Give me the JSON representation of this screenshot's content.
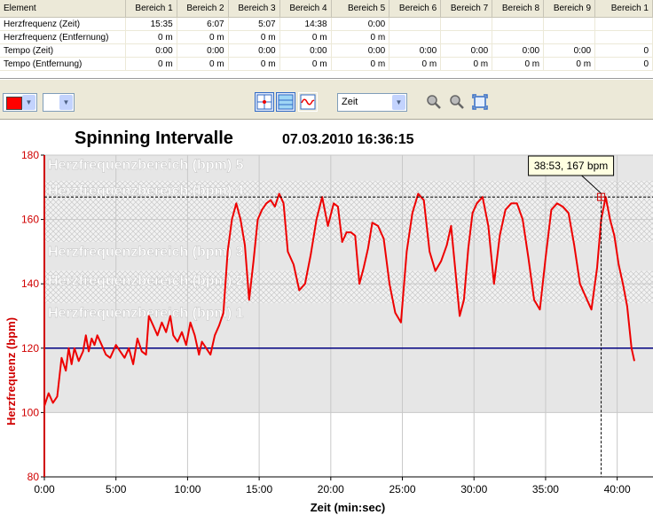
{
  "table": {
    "headers": [
      "Element",
      "Bereich 1",
      "Bereich 2",
      "Bereich 3",
      "Bereich 4",
      "Bereich 5",
      "Bereich 6",
      "Bereich 7",
      "Bereich 8",
      "Bereich 9",
      "Bereich 1"
    ],
    "rows": [
      {
        "label": "Herzfrequenz (Zeit)",
        "values": [
          "15:35",
          "6:07",
          "5:07",
          "14:38",
          "0:00",
          "",
          "",
          "",
          "",
          ""
        ]
      },
      {
        "label": "Herzfrequenz (Entfernung)",
        "values": [
          "0 m",
          "0 m",
          "0 m",
          "0 m",
          "0 m",
          "",
          "",
          "",
          "",
          ""
        ]
      },
      {
        "label": "Tempo (Zeit)",
        "values": [
          "0:00",
          "0:00",
          "0:00",
          "0:00",
          "0:00",
          "0:00",
          "0:00",
          "0:00",
          "0:00",
          "0"
        ]
      },
      {
        "label": "Tempo (Entfernung)",
        "values": [
          "0 m",
          "0 m",
          "0 m",
          "0 m",
          "0 m",
          "0 m",
          "0 m",
          "0 m",
          "0 m",
          "0"
        ]
      }
    ]
  },
  "toolbar": {
    "xaxis_mode": "Zeit",
    "line_color": "#ff0000"
  },
  "chart_data": {
    "type": "line",
    "title": "Spinning Intervalle",
    "subtitle": "07.03.2010 16:36:15",
    "xlabel": "Zeit (min:sec)",
    "ylabel": "Herzfrequenz (bpm)",
    "xlim": [
      0,
      42.5
    ],
    "ylim": [
      80,
      180
    ],
    "xticks": [
      "0:00",
      "5:00",
      "10:00",
      "15:00",
      "20:00",
      "25:00",
      "30:00",
      "35:00",
      "40:00"
    ],
    "yticks": [
      "80",
      "100",
      "120",
      "140",
      "160",
      "180"
    ],
    "zones": [
      {
        "label": "Herzfrequenzbereich (bpm) 5",
        "from": 172,
        "to": 180,
        "pattern": "solid"
      },
      {
        "label": "Herzfrequenzbereich (bpm) 4",
        "from": 153,
        "to": 172,
        "pattern": "hatch"
      },
      {
        "label": "Herzfrequenzbereich (bpm) 3",
        "from": 144,
        "to": 153,
        "pattern": "solid"
      },
      {
        "label": "Herzfrequenzbereich (bpm) 2",
        "from": 134,
        "to": 144,
        "pattern": "hatch"
      },
      {
        "label": "Herzfrequenzbereich (bpm) 1",
        "from": 100,
        "to": 134,
        "pattern": "solid"
      }
    ],
    "reference_line": 120,
    "cursor": {
      "x": 38.88,
      "y": 167,
      "label": "38:53, 167 bpm"
    },
    "series": [
      {
        "color": "#ee0000",
        "x": [
          0,
          0.3,
          0.6,
          0.9,
          1.2,
          1.5,
          1.7,
          1.9,
          2.1,
          2.4,
          2.7,
          2.9,
          3.1,
          3.3,
          3.5,
          3.7,
          4.0,
          4.3,
          4.6,
          5.0,
          5.3,
          5.6,
          5.9,
          6.2,
          6.5,
          6.8,
          7.1,
          7.3,
          7.6,
          7.9,
          8.2,
          8.5,
          8.8,
          9.0,
          9.3,
          9.6,
          9.9,
          10.2,
          10.5,
          10.8,
          11.0,
          11.3,
          11.6,
          11.9,
          12.2,
          12.5,
          12.8,
          13.1,
          13.4,
          13.7,
          14.0,
          14.3,
          14.6,
          14.9,
          15.2,
          15.5,
          15.8,
          16.1,
          16.4,
          16.7,
          17.0,
          17.4,
          17.8,
          18.2,
          18.6,
          19.0,
          19.4,
          19.8,
          20.2,
          20.5,
          20.8,
          21.1,
          21.4,
          21.7,
          22.0,
          22.3,
          22.6,
          22.9,
          23.3,
          23.7,
          24.1,
          24.5,
          24.9,
          25.3,
          25.7,
          26.1,
          26.5,
          26.9,
          27.3,
          27.7,
          28.1,
          28.4,
          28.7,
          29.0,
          29.3,
          29.6,
          29.9,
          30.2,
          30.6,
          31.0,
          31.4,
          31.8,
          32.2,
          32.6,
          33.0,
          33.4,
          33.8,
          34.2,
          34.6,
          35.0,
          35.4,
          35.8,
          36.2,
          36.6,
          37.0,
          37.4,
          37.8,
          38.2,
          38.6,
          38.88,
          39.2,
          39.5,
          39.8,
          40.1,
          40.4,
          40.7,
          41.0,
          41.2
        ],
        "y": [
          102,
          106,
          103,
          105,
          117,
          113,
          120,
          115,
          120,
          116,
          119,
          124,
          119,
          123,
          121,
          124,
          121,
          118,
          117,
          121,
          119,
          117,
          120,
          115,
          123,
          119,
          118,
          130,
          127,
          124,
          128,
          125,
          130,
          124,
          122,
          125,
          121,
          128,
          124,
          118,
          122,
          120,
          118,
          124,
          127,
          131,
          150,
          160,
          165,
          160,
          152,
          135,
          147,
          160,
          163,
          165,
          166,
          164,
          168,
          165,
          150,
          146,
          138,
          140,
          149,
          160,
          167,
          158,
          165,
          164,
          153,
          156,
          156,
          155,
          140,
          145,
          151,
          159,
          158,
          154,
          140,
          131,
          128,
          150,
          162,
          168,
          166,
          150,
          144,
          147,
          152,
          158,
          144,
          130,
          135,
          151,
          162,
          165,
          167,
          158,
          140,
          155,
          163,
          165,
          165,
          160,
          148,
          135,
          132,
          148,
          163,
          165,
          164,
          162,
          152,
          140,
          136,
          132,
          145,
          160,
          167,
          160,
          155,
          146,
          140,
          133,
          120,
          116
        ]
      }
    ]
  }
}
